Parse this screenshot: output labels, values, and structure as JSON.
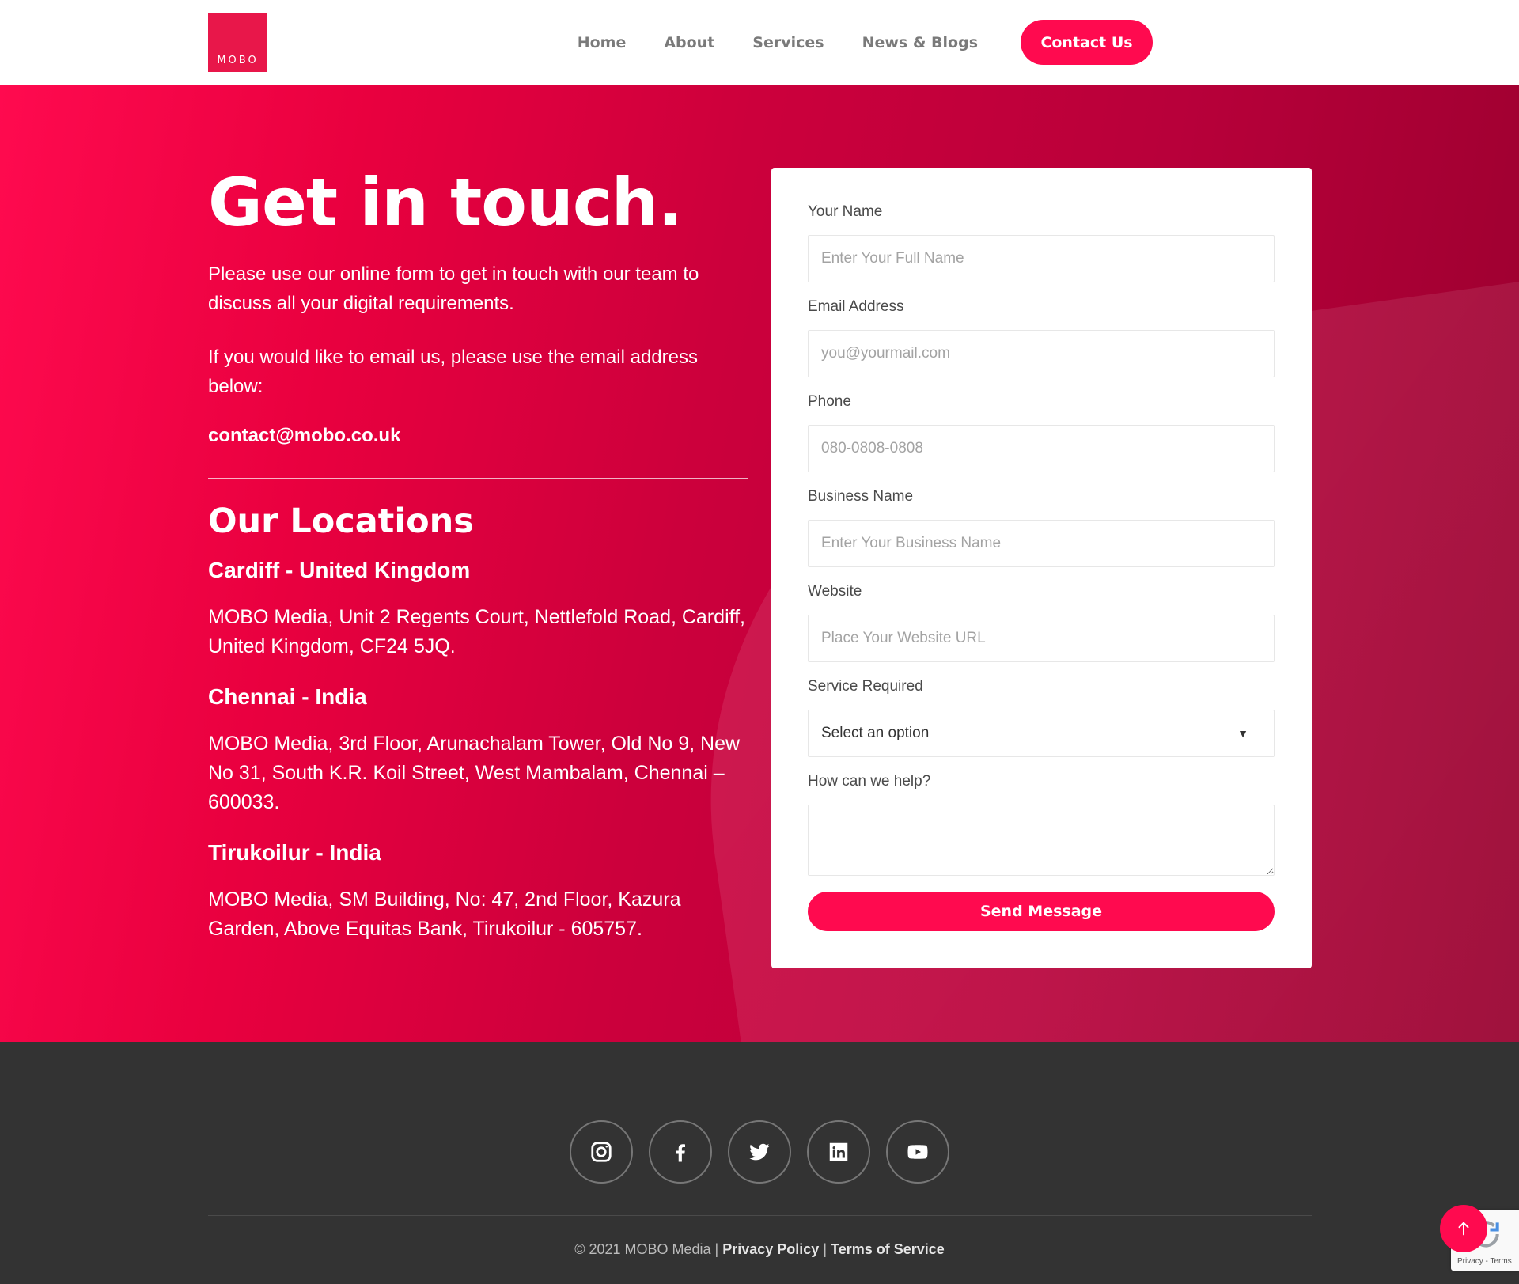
{
  "header": {
    "logo_text": "MOBO",
    "nav": [
      {
        "label": "Home"
      },
      {
        "label": "About"
      },
      {
        "label": "Services"
      },
      {
        "label": "News & Blogs"
      }
    ],
    "cta_label": "Contact Us"
  },
  "hero": {
    "title": "Get in touch.",
    "paragraph1": "Please use our online form to get in touch with our team to discuss all your digital requirements.",
    "paragraph2": "If you would like to email us, please use the email address below:",
    "email": "contact@mobo.co.uk",
    "locations_title": "Our Locations",
    "locations": [
      {
        "name": "Cardiff - United Kingdom",
        "address": "MOBO Media, Unit 2 Regents Court, Nettlefold Road, Cardiff, United Kingdom, CF24 5JQ."
      },
      {
        "name": "Chennai - India",
        "address": "MOBO Media, 3rd Floor, Arunachalam Tower, Old No 9, New No 31, South K.R. Koil Street, West Mambalam, Chennai – 600033."
      },
      {
        "name": "Tirukoilur - India",
        "address": "MOBO Media, SM Building, No: 47, 2nd Floor, Kazura Garden, Above Equitas Bank, Tirukoilur - 605757."
      }
    ]
  },
  "form": {
    "name": {
      "label": "Your Name",
      "placeholder": "Enter Your Full Name"
    },
    "email": {
      "label": "Email Address",
      "placeholder": "you@yourmail.com"
    },
    "phone": {
      "label": "Phone",
      "placeholder": "080-0808-0808"
    },
    "business": {
      "label": "Business Name",
      "placeholder": "Enter Your Business Name"
    },
    "website": {
      "label": "Website",
      "placeholder": "Place Your Website URL"
    },
    "service": {
      "label": "Service Required",
      "value": "Select an option"
    },
    "help": {
      "label": "How can we help?",
      "value": ""
    },
    "submit_label": "Send Message"
  },
  "footer": {
    "socials": [
      "instagram-icon",
      "facebook-icon",
      "twitter-icon",
      "linkedin-icon",
      "youtube-icon"
    ],
    "copyright": "© 2021 MOBO Media |",
    "privacy": "Privacy Policy",
    "separator": "|",
    "terms": "Terms of Service",
    "recaptcha_text": "Privacy - Terms"
  },
  "colors": {
    "accent": "#ff0a4f",
    "hero_dark": "#98002e",
    "footer_bg": "#333333"
  }
}
